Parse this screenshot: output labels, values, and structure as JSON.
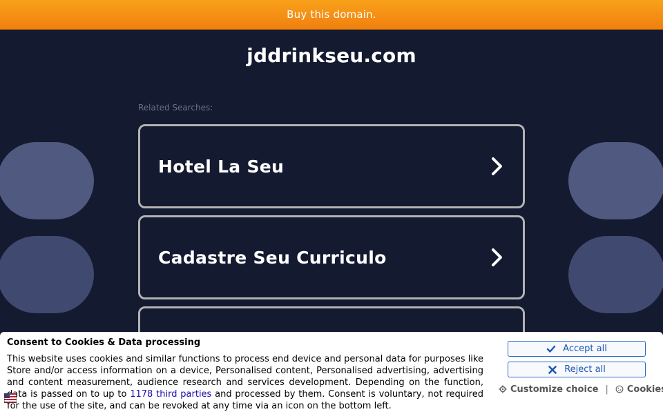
{
  "banner": {
    "label": "Buy this domain."
  },
  "domain": {
    "title": "jddrinkseu.com"
  },
  "related": {
    "label": "Related Searches:",
    "items": [
      {
        "label": "Hotel La Seu"
      },
      {
        "label": "Cadastre Seu Curriculo"
      },
      {
        "label": ""
      }
    ]
  },
  "cookie": {
    "title": "Consent to Cookies & Data processing",
    "text_before": "This website uses cookies and similar functions to process end device and personal data for purposes like Store and/or access information on a device, Personalised content, Personalised advertising, advertising and content measurement, audience research and services development. Depending on the function, data is passed on to up to ",
    "link": "1178 third parties",
    "text_after": " and processed by them. Consent is voluntary, not required for the use of the site, and can be revoked at any time via an icon on the bottom left.",
    "accept_label": "Accept all",
    "reject_label": "Reject all",
    "customize_label": "Customize choice",
    "separator": "|",
    "cookies_label": "Cookies"
  },
  "colors": {
    "banner": "#f59315",
    "background": "#141a30",
    "card_border": "#b3b3b3",
    "button_blue": "#1d56b6"
  },
  "icons": {
    "chevron": "chevron-right-icon",
    "accept": "check-icon",
    "reject": "x-icon",
    "customize": "gear-icon",
    "cookies": "cookie-icon",
    "language": "flag-icon"
  }
}
